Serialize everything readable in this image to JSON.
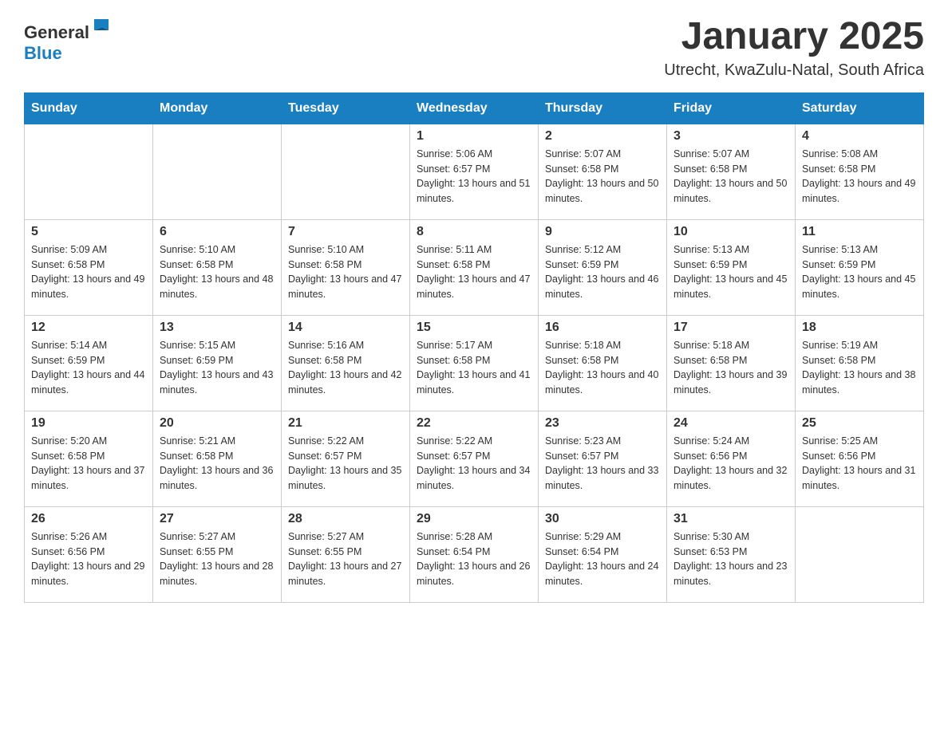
{
  "header": {
    "logo_general": "General",
    "logo_blue": "Blue",
    "title": "January 2025",
    "subtitle": "Utrecht, KwaZulu-Natal, South Africa"
  },
  "days_of_week": [
    "Sunday",
    "Monday",
    "Tuesday",
    "Wednesday",
    "Thursday",
    "Friday",
    "Saturday"
  ],
  "weeks": [
    {
      "cells": [
        {
          "empty": true
        },
        {
          "empty": true
        },
        {
          "empty": true
        },
        {
          "day": 1,
          "sunrise": "5:06 AM",
          "sunset": "6:57 PM",
          "daylight": "13 hours and 51 minutes."
        },
        {
          "day": 2,
          "sunrise": "5:07 AM",
          "sunset": "6:58 PM",
          "daylight": "13 hours and 50 minutes."
        },
        {
          "day": 3,
          "sunrise": "5:07 AM",
          "sunset": "6:58 PM",
          "daylight": "13 hours and 50 minutes."
        },
        {
          "day": 4,
          "sunrise": "5:08 AM",
          "sunset": "6:58 PM",
          "daylight": "13 hours and 49 minutes."
        }
      ]
    },
    {
      "cells": [
        {
          "day": 5,
          "sunrise": "5:09 AM",
          "sunset": "6:58 PM",
          "daylight": "13 hours and 49 minutes."
        },
        {
          "day": 6,
          "sunrise": "5:10 AM",
          "sunset": "6:58 PM",
          "daylight": "13 hours and 48 minutes."
        },
        {
          "day": 7,
          "sunrise": "5:10 AM",
          "sunset": "6:58 PM",
          "daylight": "13 hours and 47 minutes."
        },
        {
          "day": 8,
          "sunrise": "5:11 AM",
          "sunset": "6:58 PM",
          "daylight": "13 hours and 47 minutes."
        },
        {
          "day": 9,
          "sunrise": "5:12 AM",
          "sunset": "6:59 PM",
          "daylight": "13 hours and 46 minutes."
        },
        {
          "day": 10,
          "sunrise": "5:13 AM",
          "sunset": "6:59 PM",
          "daylight": "13 hours and 45 minutes."
        },
        {
          "day": 11,
          "sunrise": "5:13 AM",
          "sunset": "6:59 PM",
          "daylight": "13 hours and 45 minutes."
        }
      ]
    },
    {
      "cells": [
        {
          "day": 12,
          "sunrise": "5:14 AM",
          "sunset": "6:59 PM",
          "daylight": "13 hours and 44 minutes."
        },
        {
          "day": 13,
          "sunrise": "5:15 AM",
          "sunset": "6:59 PM",
          "daylight": "13 hours and 43 minutes."
        },
        {
          "day": 14,
          "sunrise": "5:16 AM",
          "sunset": "6:58 PM",
          "daylight": "13 hours and 42 minutes."
        },
        {
          "day": 15,
          "sunrise": "5:17 AM",
          "sunset": "6:58 PM",
          "daylight": "13 hours and 41 minutes."
        },
        {
          "day": 16,
          "sunrise": "5:18 AM",
          "sunset": "6:58 PM",
          "daylight": "13 hours and 40 minutes."
        },
        {
          "day": 17,
          "sunrise": "5:18 AM",
          "sunset": "6:58 PM",
          "daylight": "13 hours and 39 minutes."
        },
        {
          "day": 18,
          "sunrise": "5:19 AM",
          "sunset": "6:58 PM",
          "daylight": "13 hours and 38 minutes."
        }
      ]
    },
    {
      "cells": [
        {
          "day": 19,
          "sunrise": "5:20 AM",
          "sunset": "6:58 PM",
          "daylight": "13 hours and 37 minutes."
        },
        {
          "day": 20,
          "sunrise": "5:21 AM",
          "sunset": "6:58 PM",
          "daylight": "13 hours and 36 minutes."
        },
        {
          "day": 21,
          "sunrise": "5:22 AM",
          "sunset": "6:57 PM",
          "daylight": "13 hours and 35 minutes."
        },
        {
          "day": 22,
          "sunrise": "5:22 AM",
          "sunset": "6:57 PM",
          "daylight": "13 hours and 34 minutes."
        },
        {
          "day": 23,
          "sunrise": "5:23 AM",
          "sunset": "6:57 PM",
          "daylight": "13 hours and 33 minutes."
        },
        {
          "day": 24,
          "sunrise": "5:24 AM",
          "sunset": "6:56 PM",
          "daylight": "13 hours and 32 minutes."
        },
        {
          "day": 25,
          "sunrise": "5:25 AM",
          "sunset": "6:56 PM",
          "daylight": "13 hours and 31 minutes."
        }
      ]
    },
    {
      "cells": [
        {
          "day": 26,
          "sunrise": "5:26 AM",
          "sunset": "6:56 PM",
          "daylight": "13 hours and 29 minutes."
        },
        {
          "day": 27,
          "sunrise": "5:27 AM",
          "sunset": "6:55 PM",
          "daylight": "13 hours and 28 minutes."
        },
        {
          "day": 28,
          "sunrise": "5:27 AM",
          "sunset": "6:55 PM",
          "daylight": "13 hours and 27 minutes."
        },
        {
          "day": 29,
          "sunrise": "5:28 AM",
          "sunset": "6:54 PM",
          "daylight": "13 hours and 26 minutes."
        },
        {
          "day": 30,
          "sunrise": "5:29 AM",
          "sunset": "6:54 PM",
          "daylight": "13 hours and 24 minutes."
        },
        {
          "day": 31,
          "sunrise": "5:30 AM",
          "sunset": "6:53 PM",
          "daylight": "13 hours and 23 minutes."
        },
        {
          "empty": true
        }
      ]
    }
  ],
  "labels": {
    "sunrise_prefix": "Sunrise: ",
    "sunset_prefix": "Sunset: ",
    "daylight_prefix": "Daylight: "
  }
}
